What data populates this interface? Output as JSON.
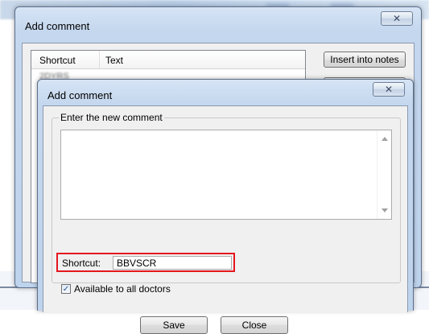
{
  "outer_dialog": {
    "title": "Add comment",
    "close_glyph": "✕",
    "list": {
      "columns": [
        "Shortcut",
        "Text"
      ],
      "first_row_shortcut": "2DYRS"
    },
    "buttons": {
      "insert_into_notes": "Insert into notes",
      "partial_list": "ist"
    }
  },
  "inner_dialog": {
    "title": "Add comment",
    "close_glyph": "✕",
    "group_label": "Enter the new comment",
    "comment_value": "",
    "shortcut_label": "Shortcut:",
    "shortcut_value": "BBVSCR",
    "available_label": "Available to all doctors",
    "available_checked": true,
    "check_glyph": "✓",
    "save_label": "Save",
    "close_label": "Close"
  },
  "colors": {
    "highlight": "#e4161f",
    "title_bar": "#c4d7ee"
  }
}
